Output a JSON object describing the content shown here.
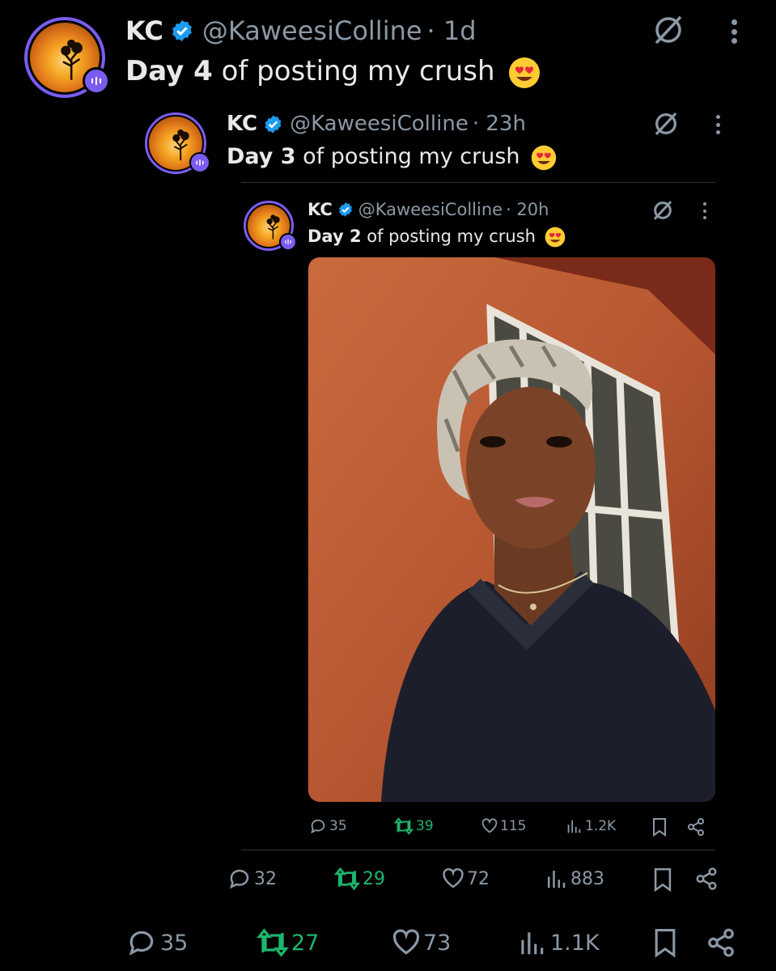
{
  "tweets": [
    {
      "name": "KC",
      "handle": "@KaweesiColline",
      "time": "· 1d",
      "text_bold": "Day 4",
      "text_rest": " of posting my crush",
      "stats": {
        "replies": "32",
        "retweets": "29",
        "likes": "72",
        "views": "883"
      }
    },
    {
      "name": "KC",
      "handle": "@KaweesiColline",
      "time": "· 23h",
      "text_bold": "Day 3",
      "text_rest": " of posting my crush",
      "stats": {
        "replies": "35",
        "retweets": "39",
        "likes": "115",
        "views": "1.2K"
      }
    },
    {
      "name": "KC",
      "handle": "@KaweesiColline",
      "time": "· 20h",
      "text_bold": "Day 2",
      "text_rest": " of posting my crush"
    }
  ],
  "bottom_stats": {
    "replies": "35",
    "retweets": "27",
    "likes": "73",
    "views": "1.1K"
  },
  "photo": {
    "description_icon": "photo-of-person"
  },
  "colors": {
    "background": "#000000",
    "verified": "#1d9bf0",
    "avatar_ring": "#7b5cf0",
    "retweet": "#1db56d",
    "muted": "#8b98a5"
  }
}
